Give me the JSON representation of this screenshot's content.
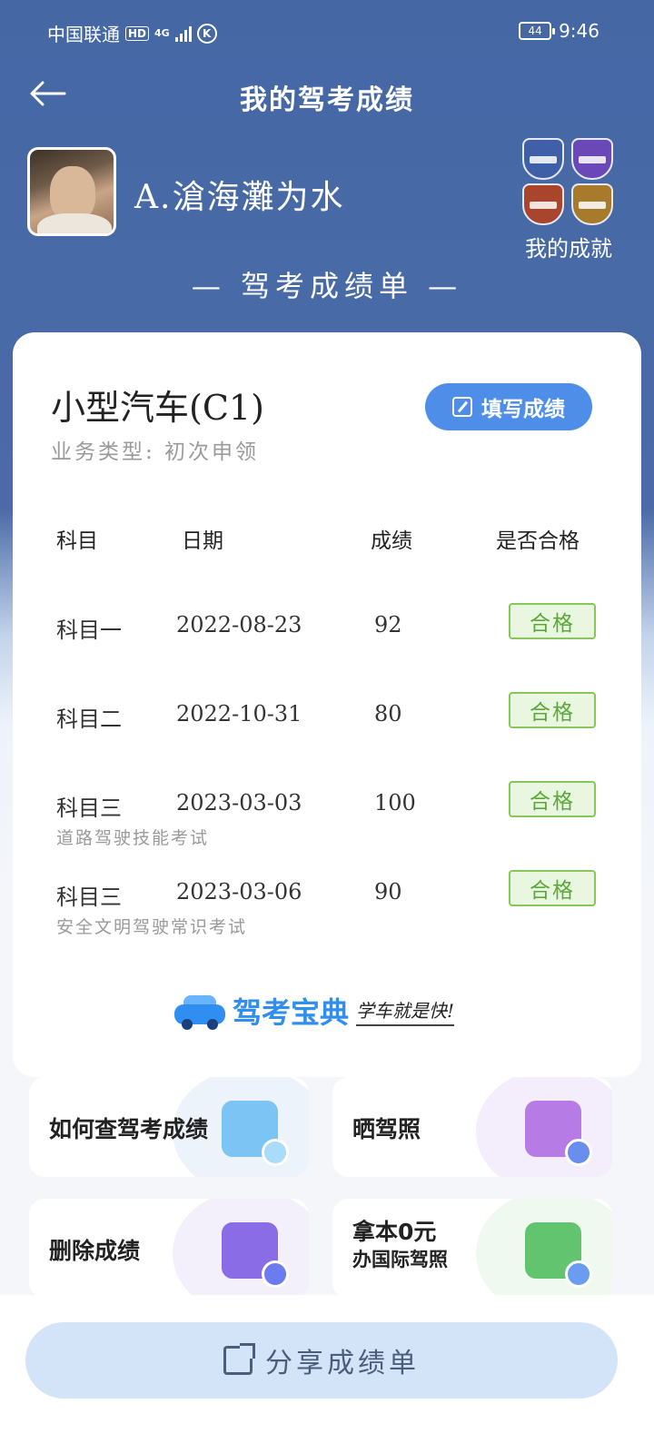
{
  "status": {
    "carrier": "中国联通",
    "hd": "HD",
    "network": "4G",
    "k_badge": "K",
    "battery": "44",
    "time": "9:46"
  },
  "nav": {
    "back_icon": "back-arrow-icon",
    "title": "我的驾考成绩"
  },
  "profile": {
    "username": "A.滄海灘为水",
    "achievements_label": "我的成就",
    "badge_colors": [
      "#3f5fa8",
      "#6b48b8",
      "#a8452c",
      "#a87a2c"
    ]
  },
  "report": {
    "title": "— 驾考成绩单 —",
    "license_type": "小型汽车(C1)",
    "business_type": "业务类型: 初次申领",
    "fill_button": "填写成绩",
    "headers": {
      "subject": "科目",
      "date": "日期",
      "score": "成绩",
      "passed": "是否合格"
    },
    "rows": [
      {
        "subject": "科目一",
        "date": "2022-08-23",
        "score": "92",
        "status": "合格",
        "note": ""
      },
      {
        "subject": "科目二",
        "date": "2022-10-31",
        "score": "80",
        "status": "合格",
        "note": ""
      },
      {
        "subject": "科目三",
        "date": "2023-03-03",
        "score": "100",
        "status": "合格",
        "note": "道路驾驶技能考试"
      },
      {
        "subject": "科目三",
        "date": "2023-03-06",
        "score": "90",
        "status": "合格",
        "note": "安全文明驾驶常识考试"
      }
    ],
    "brand_name": "驾考宝典",
    "brand_slogan": "学车就是快!"
  },
  "actions": [
    {
      "label": "如何查驾考成绩",
      "icon": "document-search-icon",
      "color": "#7cc4f4"
    },
    {
      "label": "晒驾照",
      "icon": "photo-camera-icon",
      "color": "#b77be6"
    },
    {
      "label": "删除成绩",
      "icon": "delete-record-icon",
      "color": "#8a6ce6"
    },
    {
      "label_line1": "拿本0元",
      "label_line2": "办国际驾照",
      "icon": "license-globe-icon",
      "color": "#62c46e"
    }
  ],
  "share_button": "分享成绩单"
}
